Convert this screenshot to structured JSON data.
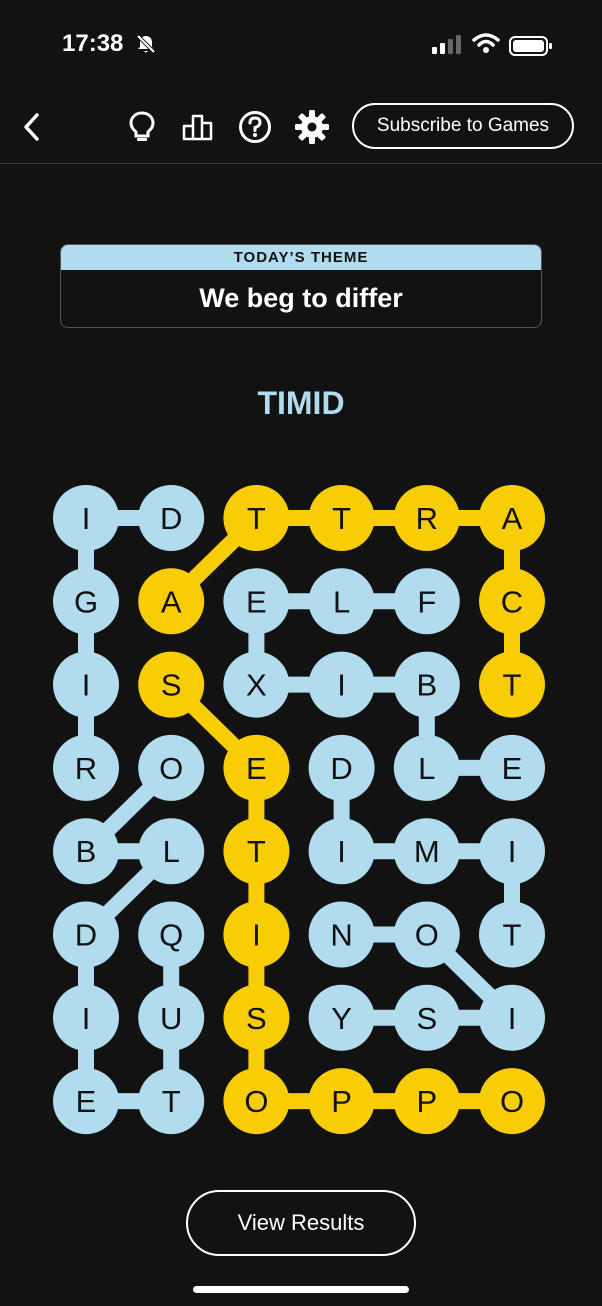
{
  "status_bar": {
    "time": "17:38"
  },
  "toolbar": {
    "icons": [
      "back-icon",
      "hint-icon",
      "stats-icon",
      "help-icon",
      "settings-icon"
    ],
    "subscribe_label": "Subscribe to Games"
  },
  "theme": {
    "label": "TODAY’S THEME",
    "title": "We beg to differ"
  },
  "current_word": "TIMID",
  "colors": {
    "theme_word": "#b1dced",
    "spangram": "#f8cd05",
    "background": "#121212"
  },
  "board": {
    "rows": [
      [
        "I",
        "D",
        "T",
        "T",
        "R",
        "A"
      ],
      [
        "G",
        "A",
        "E",
        "L",
        "F",
        "C"
      ],
      [
        "I",
        "S",
        "X",
        "I",
        "B",
        "T"
      ],
      [
        "R",
        "O",
        "E",
        "D",
        "L",
        "E"
      ],
      [
        "B",
        "L",
        "T",
        "I",
        "M",
        "I"
      ],
      [
        "D",
        "Q",
        "I",
        "N",
        "O",
        "T"
      ],
      [
        "I",
        "U",
        "S",
        "Y",
        "S",
        "I"
      ],
      [
        "E",
        "T",
        "O",
        "P",
        "P",
        "O"
      ]
    ],
    "found_words": [
      {
        "word": "RIGID",
        "type": "theme",
        "path": [
          [
            3,
            0
          ],
          [
            2,
            0
          ],
          [
            1,
            0
          ],
          [
            0,
            0
          ],
          [
            0,
            1
          ]
        ]
      },
      {
        "word": "OBLIQUE",
        "type": "theme",
        "path": [
          [
            3,
            1
          ],
          [
            4,
            0
          ],
          [
            4,
            1
          ],
          [
            5,
            0
          ],
          [
            6,
            0
          ],
          [
            7,
            0
          ],
          [
            7,
            1
          ],
          [
            6,
            1
          ],
          [
            5,
            1
          ]
        ]
      },
      {
        "word": "FLEXIBLE",
        "type": "theme",
        "path": [
          [
            1,
            4
          ],
          [
            1,
            3
          ],
          [
            1,
            2
          ],
          [
            2,
            2
          ],
          [
            2,
            3
          ],
          [
            2,
            4
          ],
          [
            3,
            4
          ],
          [
            3,
            5
          ]
        ]
      },
      {
        "word": "TIMID",
        "type": "theme",
        "path": [
          [
            5,
            5
          ],
          [
            4,
            5
          ],
          [
            4,
            4
          ],
          [
            4,
            3
          ],
          [
            3,
            3
          ]
        ]
      },
      {
        "word": "NOISY",
        "type": "theme",
        "path": [
          [
            5,
            3
          ],
          [
            5,
            4
          ],
          [
            6,
            5
          ],
          [
            6,
            4
          ],
          [
            6,
            3
          ]
        ]
      },
      {
        "word": "ATTRACT",
        "type": "spangram",
        "path": [
          [
            1,
            1
          ],
          [
            0,
            2
          ],
          [
            0,
            3
          ],
          [
            0,
            4
          ],
          [
            0,
            5
          ],
          [
            1,
            5
          ],
          [
            2,
            5
          ]
        ]
      },
      {
        "word": "SETISOPPO",
        "type": "spangram",
        "path": [
          [
            2,
            1
          ],
          [
            3,
            2
          ],
          [
            4,
            2
          ],
          [
            5,
            2
          ],
          [
            6,
            2
          ],
          [
            7,
            2
          ],
          [
            7,
            3
          ],
          [
            7,
            4
          ],
          [
            7,
            5
          ]
        ]
      }
    ]
  },
  "view_results_label": "View Results"
}
